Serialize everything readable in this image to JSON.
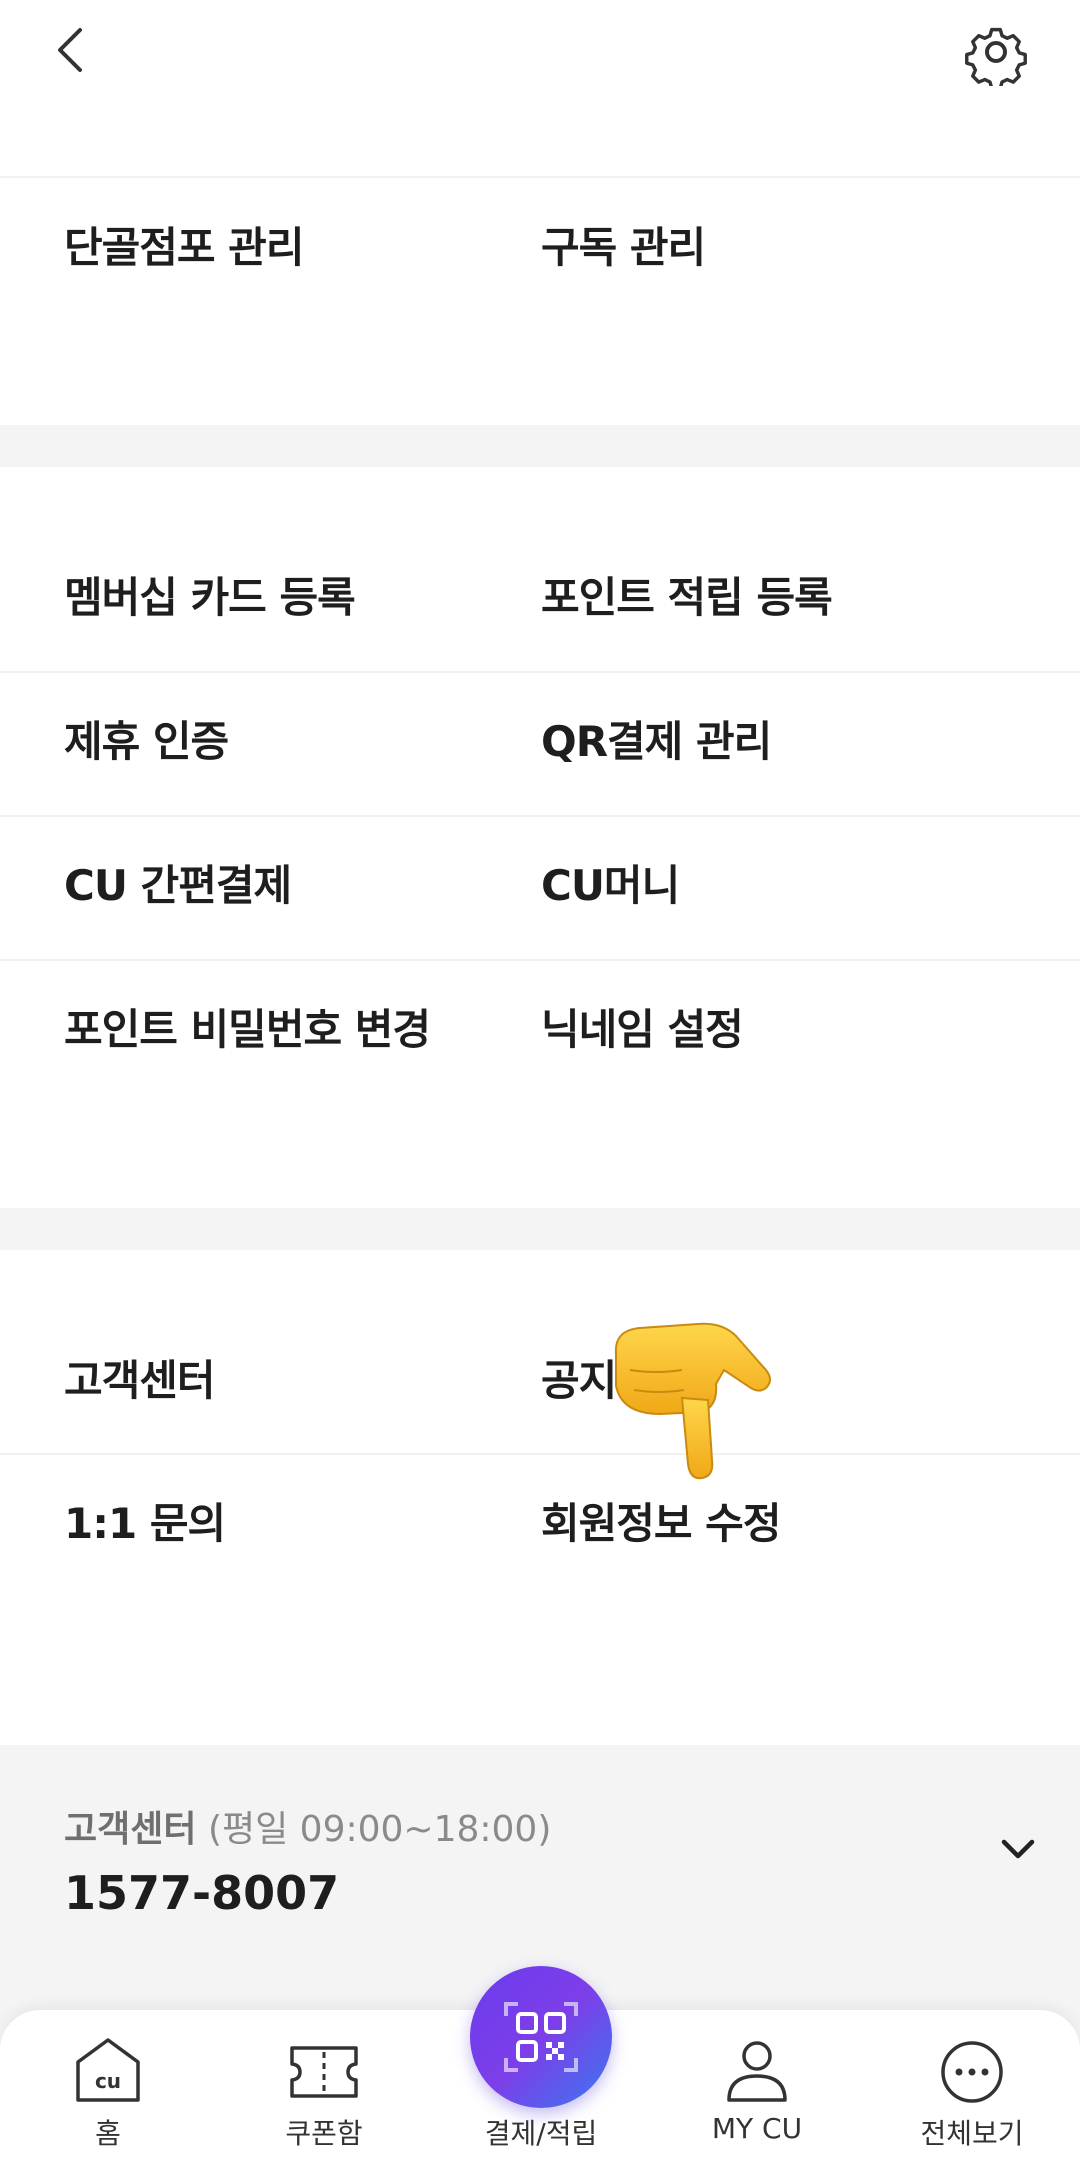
{
  "sections": [
    {
      "rows": [
        {
          "left": "단골점포 관리",
          "right": "구독 관리"
        }
      ]
    },
    {
      "rows": [
        {
          "left": "멤버십 카드 등록",
          "right": "포인트 적립 등록"
        },
        {
          "left": "제휴 인증",
          "right": "QR결제 관리"
        },
        {
          "left": "CU 간편결제",
          "right": "CU머니"
        },
        {
          "left": "포인트 비밀번호 변경",
          "right": "닉네임 설정"
        }
      ]
    },
    {
      "rows": [
        {
          "left": "고객센터",
          "right": "공지"
        },
        {
          "left": "1:1 문의",
          "right": "회원정보 수정"
        }
      ]
    }
  ],
  "customer_service": {
    "title": "고객센터",
    "hours": "(평일 09:00~18:00)",
    "phone": "1577-8007"
  },
  "bottom_nav": [
    {
      "label": "홈",
      "icon": "home-icon",
      "icon_text": "cu"
    },
    {
      "label": "쿠폰함",
      "icon": "ticket-icon"
    },
    {
      "label": "결제/적립",
      "icon": "qr-code-icon"
    },
    {
      "label": "MY CU",
      "icon": "person-icon"
    },
    {
      "label": "전체보기",
      "icon": "more-icon"
    }
  ],
  "icons": {
    "back": "chevron-left-icon",
    "settings": "gear-icon",
    "expand": "chevron-down-icon",
    "overlay": "pointing-hand-icon"
  },
  "colors": {
    "divider": "#f4f4f4",
    "fab_gradient_start": "#6a3cf0",
    "fab_gradient_end": "#3a78f0",
    "text": "#1e1e1e"
  }
}
